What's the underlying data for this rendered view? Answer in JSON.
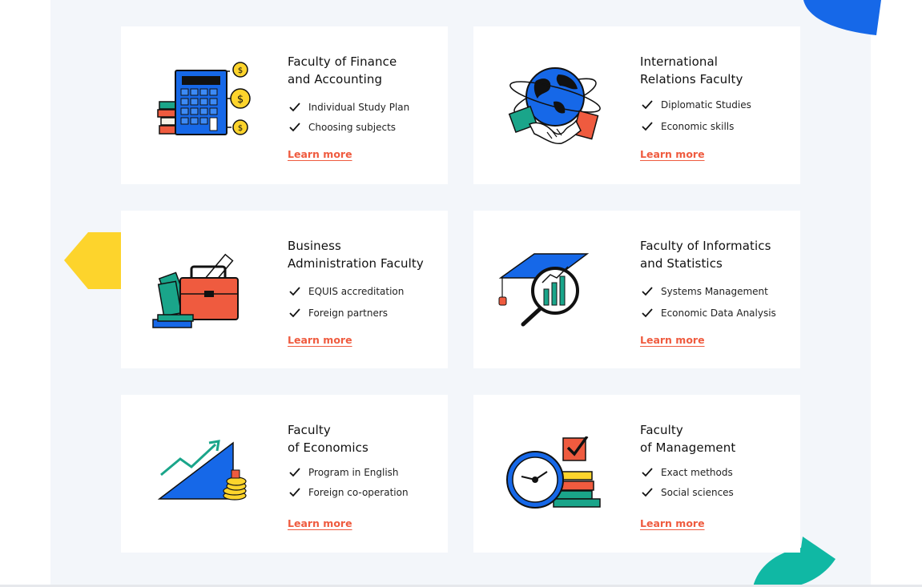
{
  "colors": {
    "accent": "#ef5b3f",
    "blue": "#1668e8",
    "yellow": "#fdd42c",
    "teal": "#10b8a4",
    "panel_bg": "#f3f6fa"
  },
  "faculties": [
    {
      "title_line1": "Faculty of Finance",
      "title_line2": "and Accounting",
      "features": [
        "Individual Study Plan",
        "Choosing subjects"
      ],
      "link": "Learn more",
      "icon": "calculator-icon"
    },
    {
      "title_line1": "International",
      "title_line2": "Relations Faculty",
      "features": [
        "Diplomatic Studies",
        "Economic skills"
      ],
      "link": "Learn more",
      "icon": "globe-handshake-icon"
    },
    {
      "title_line1": "Business",
      "title_line2": "Administration Faculty",
      "features": [
        "EQUIS accreditation",
        "Foreign partners"
      ],
      "link": "Learn more",
      "icon": "briefcase-icon"
    },
    {
      "title_line1": "Faculty of Informatics",
      "title_line2": "and Statistics",
      "features": [
        "Systems Management",
        "Economic Data Analysis"
      ],
      "link": "Learn more",
      "icon": "graduation-magnifier-icon"
    },
    {
      "title_line1": "Faculty",
      "title_line2": "of Economics",
      "features": [
        "Program in English",
        "Foreign co-operation"
      ],
      "link": "Learn more",
      "icon": "growth-chart-icon"
    },
    {
      "title_line1": "Faculty",
      "title_line2": "of Management",
      "features": [
        "Exact methods",
        "Social sciences"
      ],
      "link": "Learn more",
      "icon": "clock-books-icon"
    }
  ]
}
